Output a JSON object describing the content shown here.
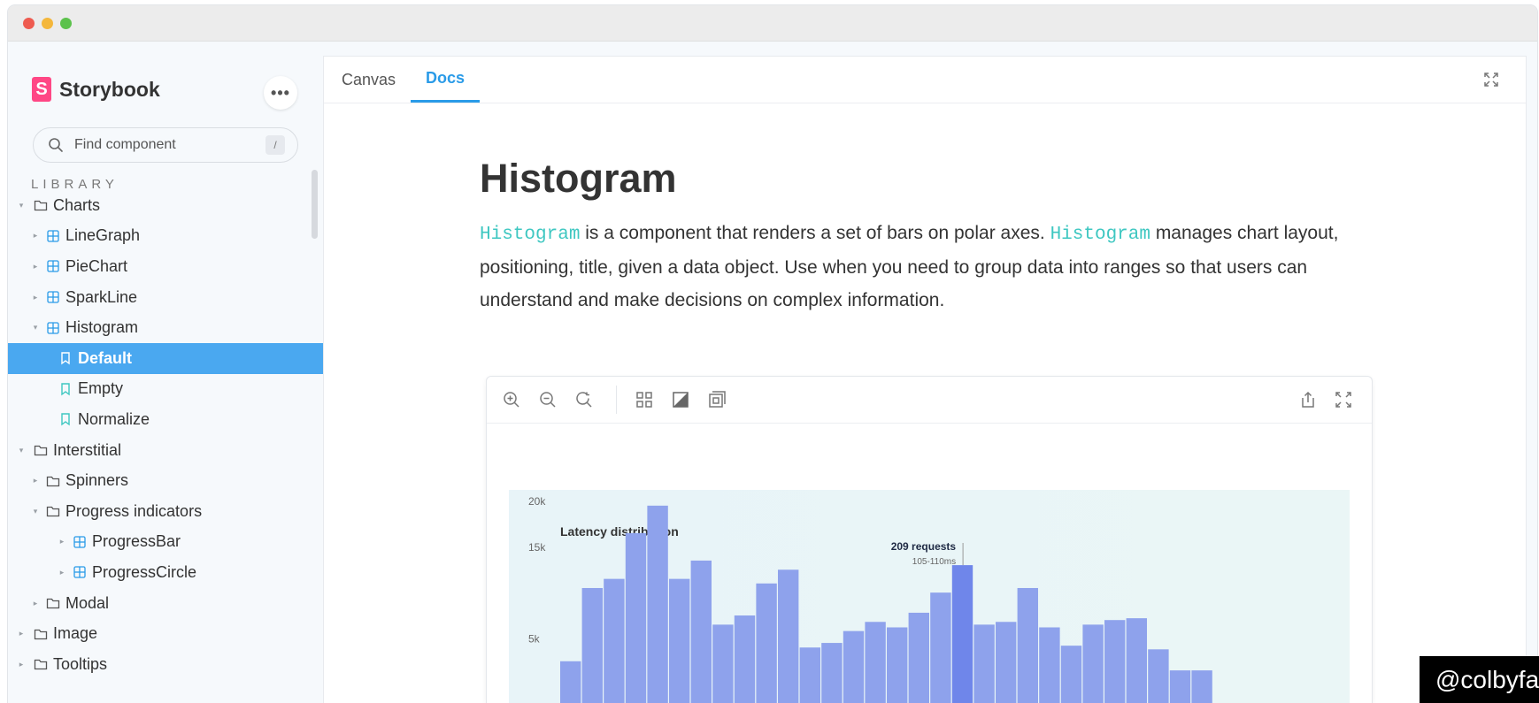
{
  "window": {
    "dots": [
      "#ee5b50",
      "#f4b73c",
      "#5cc24c"
    ]
  },
  "sidebar": {
    "brand": "Storybook",
    "brand_letter": "S",
    "more_label": "•••",
    "search": {
      "placeholder": "Find component",
      "shortcut": "/"
    },
    "section_title": "LIBRARY",
    "tree": [
      {
        "label": "Charts",
        "type": "folder",
        "expanded": true
      },
      {
        "label": "LineGraph",
        "type": "component",
        "expanded": false
      },
      {
        "label": "PieChart",
        "type": "component",
        "expanded": false
      },
      {
        "label": "SparkLine",
        "type": "component",
        "expanded": false
      },
      {
        "label": "Histogram",
        "type": "component",
        "expanded": true
      },
      {
        "label": "Default",
        "type": "story",
        "selected": true
      },
      {
        "label": "Empty",
        "type": "story"
      },
      {
        "label": "Normalize",
        "type": "story"
      },
      {
        "label": "Interstitial",
        "type": "folder",
        "expanded": true
      },
      {
        "label": "Spinners",
        "type": "folder",
        "expanded": false
      },
      {
        "label": "Progress indicators",
        "type": "folder",
        "expanded": true
      },
      {
        "label": "ProgressBar",
        "type": "component",
        "expanded": false
      },
      {
        "label": "ProgressCircle",
        "type": "component",
        "expanded": false
      },
      {
        "label": "Modal",
        "type": "folder",
        "expanded": false
      },
      {
        "label": "Image",
        "type": "folder",
        "expanded": false
      },
      {
        "label": "Tooltips",
        "type": "folder",
        "expanded": false
      }
    ]
  },
  "main": {
    "tabs": [
      {
        "label": "Canvas",
        "active": false
      },
      {
        "label": "Docs",
        "active": true
      }
    ],
    "title": "Histogram",
    "description": {
      "code1": "Histogram",
      "text1": " is a component that renders a set of bars on polar axes. ",
      "code2": "Histogram",
      "text2": " manages chart layout, positioning, title, given a data object. Use when you need to group data into ranges so that users can understand and make decisions on complex information."
    }
  },
  "chart_data": {
    "type": "bar",
    "title": "Latency distribution",
    "y_ticks": [
      "20k",
      "15k",
      "5k"
    ],
    "y_tick_values": [
      20000,
      15000,
      5000
    ],
    "values": [
      3500,
      11500,
      12500,
      17500,
      20500,
      12500,
      14500,
      7500,
      8500,
      12000,
      13500,
      5000,
      5500,
      6800,
      7800,
      7200,
      8800,
      11000,
      14000,
      7500,
      7800,
      11500,
      7200,
      5200,
      7500,
      8000,
      8200,
      4800,
      2500,
      2500
    ],
    "highlight_index": 18,
    "tooltip": {
      "title": "209 requests",
      "subtitle": "105-110ms"
    },
    "bar_color": "#8ea2ec",
    "highlight_color": "#6f86ea"
  },
  "watermark": "@colbyfa"
}
